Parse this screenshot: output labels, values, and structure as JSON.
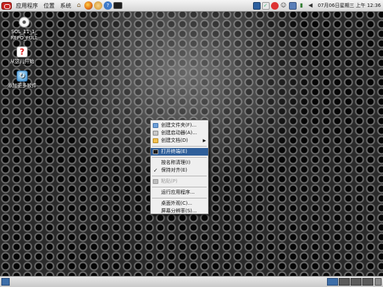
{
  "top_panel": {
    "menus": [
      "应用程序",
      "位置",
      "系统"
    ],
    "launchers": [
      "home-icon",
      "firefox-icon",
      "mail-icon",
      "help-icon",
      "terminal-icon"
    ],
    "tray_icons": [
      "monitor-icon",
      "update-icon",
      "software-icon",
      "user-icon",
      "network-icon",
      "power-icon",
      "volume-icon"
    ],
    "clock": "07月06日星期三 上午 12:36"
  },
  "desktop_icons": [
    {
      "label_line1": "SOL_11_1_",
      "label_line2": "REPO_FULL",
      "icon": "disc-icon"
    },
    {
      "label_line1": "从这儿开始",
      "icon": "start-here-icon"
    },
    {
      "label_line1": "添加更多软件",
      "icon": "add-software-icon"
    }
  ],
  "context_menu": {
    "items": [
      {
        "label": "创建文件夹(F)...",
        "icon": "folder-icon"
      },
      {
        "label": "创建启动器(A)...",
        "icon": "launcher-icon"
      },
      {
        "label": "创建文档(D)",
        "icon": "document-icon",
        "submenu": true
      },
      {
        "label": "打开终端(E)",
        "icon": "terminal-icon",
        "highlighted": true
      },
      {
        "label": "按名称清理(I)"
      },
      {
        "label": "保持对齐(E)",
        "checked": true
      },
      {
        "label": "粘贴(P)",
        "icon": "paste-icon",
        "disabled": true
      },
      {
        "label": "运行应用程序..."
      },
      {
        "label": "桌面外观(C)..."
      },
      {
        "label": "屏幕分辨率(S)..."
      }
    ]
  },
  "bottom_panel": {
    "workspaces": 4,
    "active_workspace": 1
  },
  "colors": {
    "highlight": "#2f5f9a",
    "panel": "#e0e0e0",
    "menu_bg": "#efefef"
  }
}
